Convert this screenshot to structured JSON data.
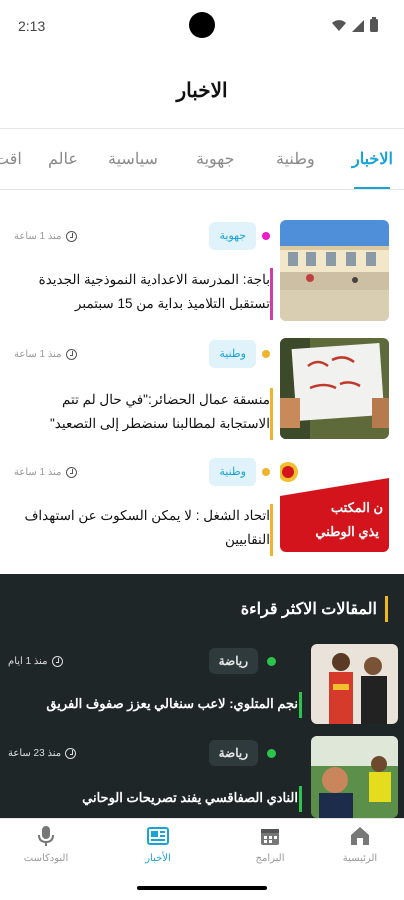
{
  "status_bar": {
    "time": "2:13"
  },
  "header": {
    "title": "الاخبار"
  },
  "tabs": [
    {
      "label": "الاخبار",
      "active": true
    },
    {
      "label": "وطنية"
    },
    {
      "label": "جهوية"
    },
    {
      "label": "سياسية"
    },
    {
      "label": "عالم"
    },
    {
      "label": "اقت"
    }
  ],
  "news": [
    {
      "tag": "جهوية",
      "dot_color": "#e91ec8",
      "time": "منذ 1 ساعة",
      "title_line1": "باجة: المدرسة الاعدادية النموذجية الجديدة",
      "title_line2": "تستقبل التلاميذ بداية من 15 سبتمبر",
      "image": "school-photo"
    },
    {
      "tag": "وطنية",
      "dot_color": "#f0b32e",
      "time": "منذ 1 ساعة",
      "title_line1": "منسقة عمال الحضائر:\"في حال لم تتم",
      "title_line2": "الاستجابة لمطالبنا سنضطر إلى التصعيد\"",
      "image": "protest-sign-photo"
    },
    {
      "tag": "وطنية",
      "dot_color": "#f0b32e",
      "time": "منذ 1 ساعة",
      "title_line1": "اتحاد الشغل : لا يمكن السكوت عن استهداف",
      "title_line2": "النقابيين",
      "image": "ugtt-banner",
      "image_text_1": "ن المكتب",
      "image_text_2": "يذي الوطني"
    }
  ],
  "most_read": {
    "title": "المقالات الاكثر قراءة",
    "items": [
      {
        "tag": "رياضة",
        "time": "منذ 1 ايام",
        "title": "نجم المتلوي: لاعب سنغالي يعزز صفوف الفريق",
        "image": "players-photo"
      },
      {
        "tag": "رياضة",
        "time": "منذ 23 ساعة",
        "title": "النادي الصفاقسي يفند تصريحات الوحاني",
        "image": "football-photo"
      }
    ]
  },
  "bottom_nav": [
    {
      "label": "الرئيسية",
      "icon": "home-icon"
    },
    {
      "label": "البرامج",
      "icon": "calendar-icon"
    },
    {
      "label": "الأخبار",
      "icon": "news-icon",
      "active": true
    },
    {
      "label": "البودكاست",
      "icon": "microphone-icon"
    }
  ],
  "colors": {
    "accent": "#1aa3d6",
    "dark_section": "#1f2628",
    "highlight_yellow": "#f3b81e",
    "sport_green": "#2ac54a",
    "regional_magenta": "#e91ec8"
  }
}
